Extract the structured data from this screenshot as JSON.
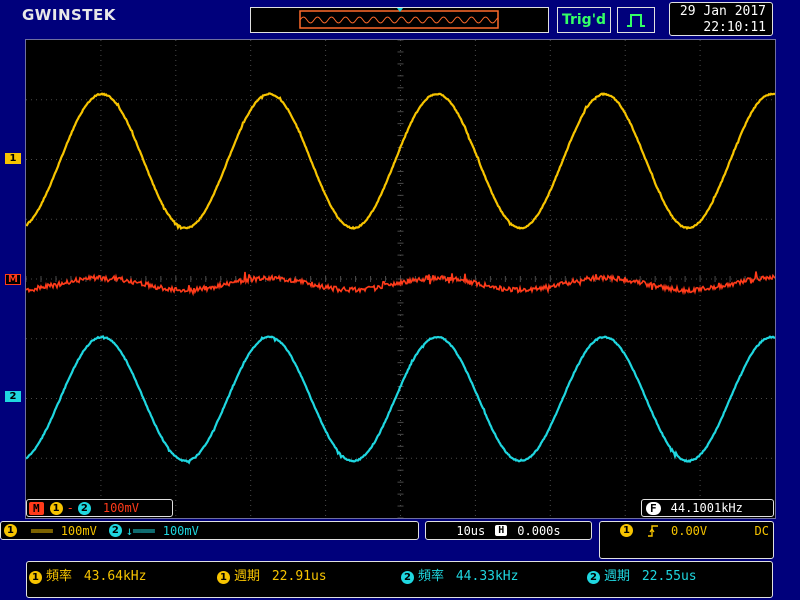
{
  "header": {
    "brand": "GWINSTEK",
    "trigger_status": "Trig'd",
    "date": "29 Jan 2017",
    "time": "22:10:11"
  },
  "markers": {
    "ch1": "1",
    "math": "M",
    "ch2": "2"
  },
  "math_label": {
    "badge": "M",
    "ch_a": "1",
    "operator": "-",
    "ch_b": "2",
    "scale": "100mV"
  },
  "freq_counter": {
    "badge": "F",
    "value": "44.1001kHz"
  },
  "channels": {
    "ch1": {
      "num": "1",
      "coupling": "═══",
      "scale": "100mV"
    },
    "ch2": {
      "num": "2",
      "coupling": "↓═══",
      "scale": "100mV"
    }
  },
  "timebase": {
    "scale": "10us",
    "h_icon": "H",
    "position": "0.000s"
  },
  "trigger": {
    "source": "1",
    "slope_icon": "rising-edge",
    "level": "0.00V",
    "coupling": "DC"
  },
  "measurements": [
    {
      "ch": "1",
      "label": "頻率",
      "value": "43.64kHz"
    },
    {
      "ch": "1",
      "label": "週期",
      "value": "22.91us"
    },
    {
      "ch": "2",
      "label": "頻率",
      "value": "44.33kHz"
    },
    {
      "ch": "2",
      "label": "週期",
      "value": "22.55us"
    }
  ],
  "colors": {
    "ch1": "#f7c400",
    "ch2": "#1fd7e0",
    "math": "#ff3b1a",
    "background": "#00007b",
    "screen": "#000000",
    "grid": "#5a5a5a"
  }
}
